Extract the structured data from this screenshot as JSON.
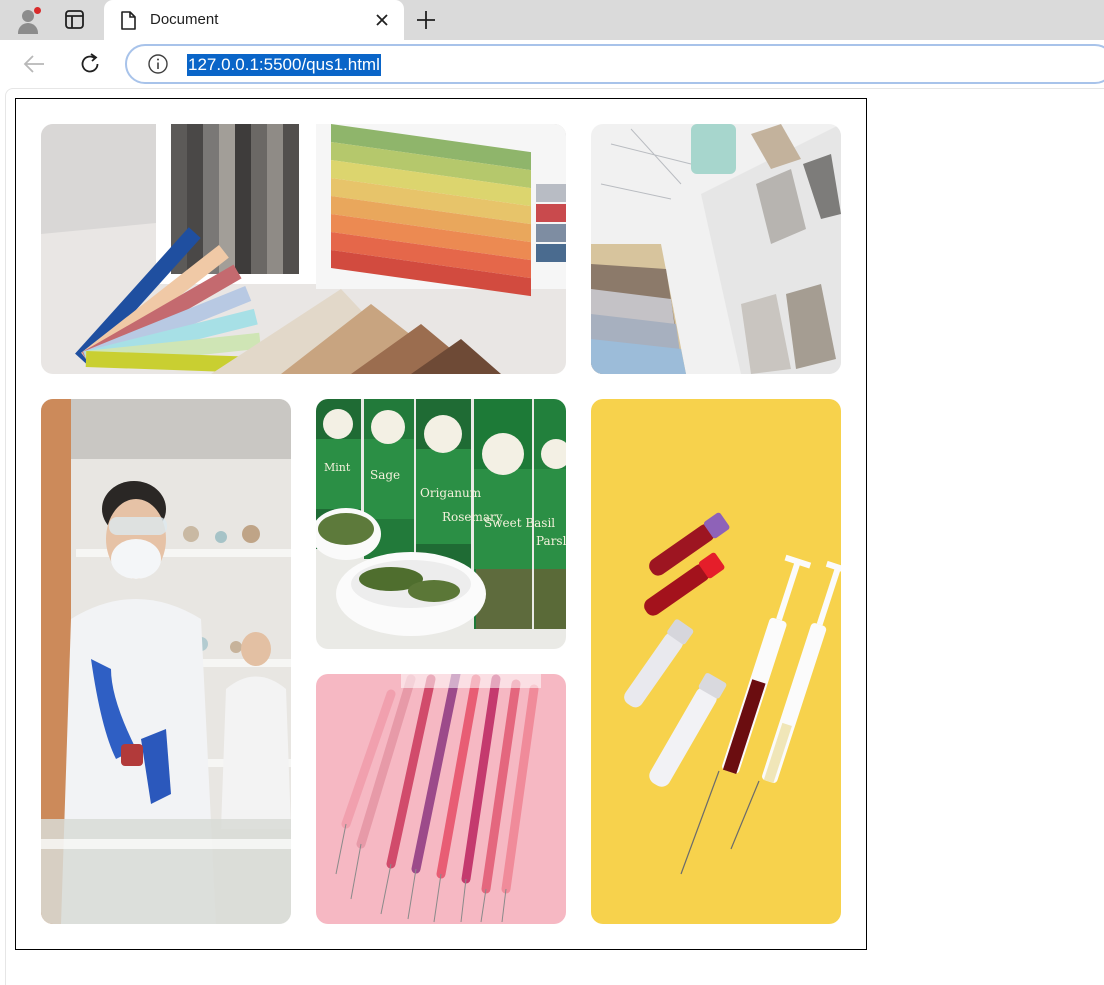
{
  "browser": {
    "tab_title": "Document",
    "url": "127.0.0.1:5500/qus1.html",
    "icons": {
      "profile": "profile-avatar-icon",
      "tab_actions": "tab-actions-icon",
      "favicon": "document-icon",
      "close": "close-icon",
      "new_tab": "plus-icon",
      "back": "back-arrow-icon",
      "reload": "reload-icon",
      "site_info": "info-icon"
    },
    "colors": {
      "url_highlight": "#0a65c8",
      "omnibox_border": "#a8c3ea",
      "profile_badge": "#d92b2b"
    }
  },
  "gallery": {
    "images": [
      {
        "subject": "fabric-and-color-swatches-photo"
      },
      {
        "subject": "interior-material-samples-photo"
      },
      {
        "subject": "lab-scientist-photo"
      },
      {
        "subject": "spice-jars-photo",
        "jar_labels": [
          "Mint",
          "Sage",
          "Origanum",
          "Rosemary",
          "Sweet Basil",
          "Parsley"
        ]
      },
      {
        "subject": "syringes-on-pink-photo"
      },
      {
        "subject": "blood-samples-on-yellow-photo"
      }
    ]
  }
}
